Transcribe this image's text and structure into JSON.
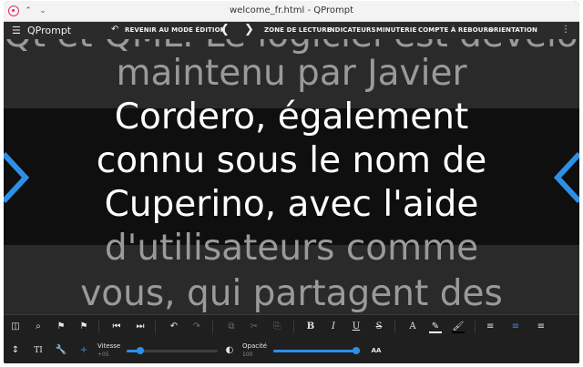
{
  "window": {
    "title": "welcome_fr.html - QPrompt",
    "up_glyph": "⌃",
    "down_glyph": "⌄"
  },
  "menubar": {
    "menu_glyph": "☰",
    "app_name": "QPrompt",
    "back_glyph": "↶",
    "back_to_edit": "REVENIR AU MODE ÉDITION",
    "prev_glyph": "❮",
    "next_glyph": "❯",
    "reading_zone": "ZONE DE LECTURE",
    "indicators": "INDICATEURS",
    "timer": "MINUTERIE",
    "countdown": "COMPTE À REBOURS",
    "orientation": "ORIENTATION",
    "more_glyph": "⋮"
  },
  "prompter": {
    "lines": [
      "Qt et QML. Le logiciel est développé et",
      "maintenu par Javier",
      "Cordero, également",
      "connu sous le nom de",
      "Cuperino, avec l'aide",
      "d'utilisateurs comme",
      "vous, qui partagent des"
    ],
    "accent_color": "#2f8fe6"
  },
  "toolbar": {
    "glyphs": {
      "layout": "◫",
      "search": "⌕",
      "bookmark_add": "⚑",
      "bookmark": "⚑",
      "skip_back": "⏮",
      "skip_fwd": "⏭",
      "undo": "↶",
      "redo": "↷",
      "copy": "⧉",
      "cut": "✂",
      "paste": "⎘",
      "bold": "B",
      "italic": "I",
      "underline": "U",
      "strike": "S",
      "font_color": "A",
      "highlight": "✎",
      "brush": "🖌",
      "align_left": "≡",
      "align_center": "≡",
      "align_right": "≡",
      "height": "↕",
      "font_size": "TI",
      "wrench": "🔧",
      "add": "+",
      "contrast": "◐",
      "font_scale": "AA"
    },
    "speed_label": "Vitesse",
    "speed_value": "+05",
    "speed_level": 0.15,
    "opacity_label": "Opacité",
    "opacity_value": "100",
    "opacity_level": 1.0
  }
}
